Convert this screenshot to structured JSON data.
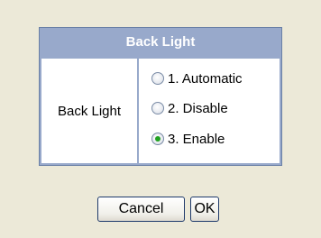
{
  "dialog": {
    "title": "Back Light",
    "field_label": "Back Light",
    "options": [
      {
        "label": "1. Automatic",
        "selected": false
      },
      {
        "label": "2. Disable",
        "selected": false
      },
      {
        "label": "3. Enable",
        "selected": true
      }
    ]
  },
  "buttons": {
    "cancel_label": "Cancel",
    "ok_label": "OK"
  },
  "colors": {
    "background": "#ece9d8",
    "header": "#98a9cb",
    "radio_selected": "#21a121"
  }
}
